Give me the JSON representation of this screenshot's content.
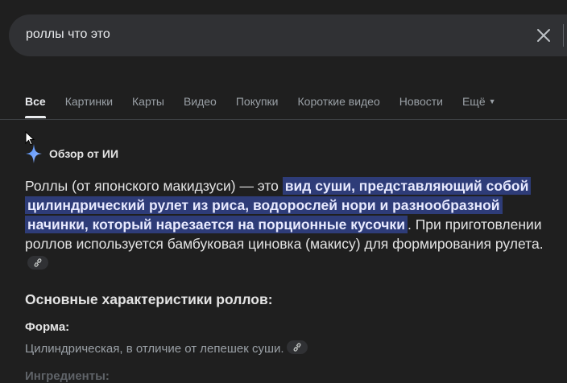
{
  "search": {
    "query": "роллы что это"
  },
  "tabs": [
    {
      "label": "Все"
    },
    {
      "label": "Картинки"
    },
    {
      "label": "Карты"
    },
    {
      "label": "Видео"
    },
    {
      "label": "Покупки"
    },
    {
      "label": "Короткие видео"
    },
    {
      "label": "Новости"
    },
    {
      "label": "Ещё"
    }
  ],
  "ai_overview": {
    "title": "Обзор от ИИ",
    "intro_text": "Роллы (от японского макидзуси) — это ",
    "highlight_text": "вид суши, представляющий собой цилиндрический рулет из риса, водорослей нори и разнообразной начинки, который нарезается на порционные кусочки",
    "rest_text": ". При приготовлении роллов используется бамбуковая циновка (макису) для формирования рулета.",
    "section_title": "Основные характеристики роллов:",
    "form_label": "Форма:",
    "form_text": "Цилиндрическая, в отличие от лепешек суши.",
    "ingredients_label": "Ингредиенты:"
  },
  "colors": {
    "background": "#1f1f1f",
    "search_bg": "#303134",
    "highlight_bg": "#2e3c78"
  }
}
